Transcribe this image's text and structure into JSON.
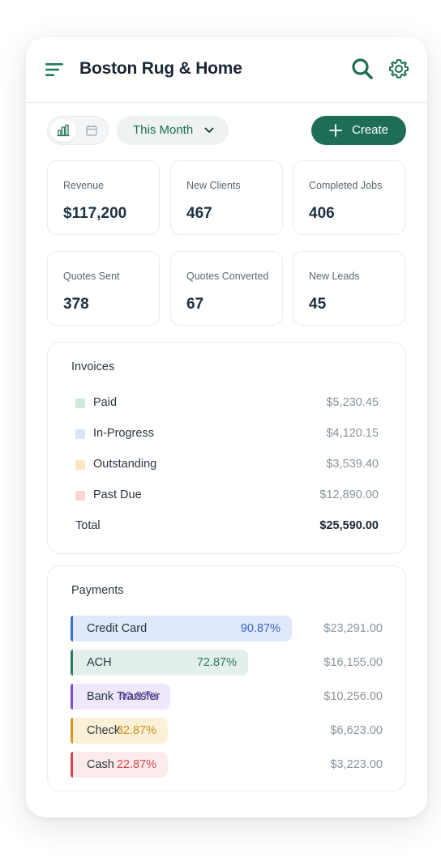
{
  "header": {
    "title": "Boston Rug & Home",
    "icons": [
      "menu-icon",
      "search-icon",
      "gear-icon"
    ]
  },
  "toolbar": {
    "view_icons": [
      "bar-chart-icon",
      "calendar-icon"
    ],
    "period": "This Month",
    "create_label": "Create"
  },
  "stats": [
    {
      "label": "Revenue",
      "value": "$117,200"
    },
    {
      "label": "New Clients",
      "value": "467"
    },
    {
      "label": "Completed Jobs",
      "value": "406"
    },
    {
      "label": "Quotes Sent",
      "value": "378"
    },
    {
      "label": "Quotes Converted",
      "value": "67"
    },
    {
      "label": "New Leads",
      "value": "45"
    }
  ],
  "invoices": {
    "title": "Invoices",
    "rows": [
      {
        "label": "Paid",
        "value": "$5,230.45",
        "color": "#cfe9dc"
      },
      {
        "label": "In-Progress",
        "value": "$4,120.15",
        "color": "#d8e6f7"
      },
      {
        "label": "Outstanding",
        "value": "$3,539.40",
        "color": "#fbe6c6"
      },
      {
        "label": "Past Due",
        "value": "$12,890.00",
        "color": "#f8d5d7"
      }
    ],
    "total_label": "Total",
    "total_value": "$25,590.00"
  },
  "payments": {
    "title": "Payments",
    "rows": [
      {
        "label": "Credit Card",
        "pct_label": "90.87%",
        "fill": 0.9087,
        "value": "$23,291.00",
        "bg": "#dfe9fb",
        "edge": "#3d6fd1",
        "text": "#3a64c4"
      },
      {
        "label": "ACH",
        "pct_label": "72.87%",
        "fill": 0.7287,
        "value": "$16,155.00",
        "bg": "#e3f0ea",
        "edge": "#2f7a5f",
        "text": "#2f7a5f"
      },
      {
        "label": "Bank Transfer",
        "pct_label": "40.87%",
        "fill": 0.4087,
        "value": "$10,256.00",
        "bg": "#efe7fb",
        "edge": "#7c4fd6",
        "text": "#7a4fd2"
      },
      {
        "label": "Check",
        "pct_label": "32.87%",
        "fill": 0.3287,
        "value": "$6,623.00",
        "bg": "#fcf1d6",
        "edge": "#d19a2a",
        "text": "#c98f1c"
      },
      {
        "label": "Cash",
        "pct_label": "22.87%",
        "fill": 0.2287,
        "value": "$3,223.00",
        "bg": "#fcebeb",
        "edge": "#d4474d",
        "text": "#d4474d"
      }
    ]
  }
}
